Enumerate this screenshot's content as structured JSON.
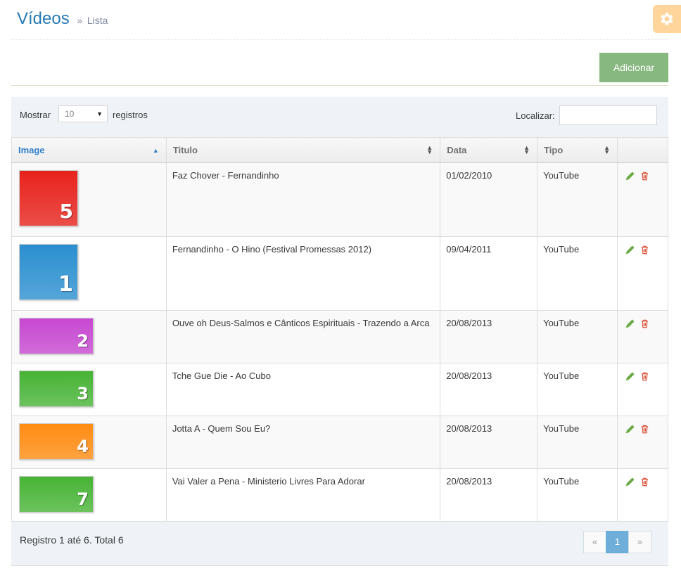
{
  "header": {
    "title": "Vídeos",
    "separator": "»",
    "subtitle": "Lista"
  },
  "toolbar": {
    "add_label": "Adicionar"
  },
  "controls": {
    "show_label": "Mostrar",
    "page_size": "10",
    "records_label": "registros",
    "search_label": "Localizar:",
    "search_value": ""
  },
  "columns": [
    "Image",
    "Titulo",
    "Data",
    "Tipo"
  ],
  "rows": [
    {
      "thumb_label": "5",
      "thumb_color": "#e8221c",
      "title": "Faz Chover - Fernandinho",
      "date": "01/02/2010",
      "type": "YouTube"
    },
    {
      "thumb_label": "1",
      "thumb_color": "#2b8fd0",
      "title": "Fernandinho - O Hino (Festival Promessas 2012)",
      "date": "09/04/2011",
      "type": "YouTube"
    },
    {
      "thumb_label": "2",
      "thumb_color": "#c748d1",
      "title": "Ouve oh Deus-Salmos e Cânticos Espirituais - Trazendo a Arca",
      "date": "20/08/2013",
      "type": "YouTube"
    },
    {
      "thumb_label": "3",
      "thumb_color": "#47b335",
      "title": "Tche Gue Die - Ao Cubo",
      "date": "20/08/2013",
      "type": "YouTube"
    },
    {
      "thumb_label": "4",
      "thumb_color": "#ff8c12",
      "title": "Jotta A - Quem Sou Eu?",
      "date": "20/08/2013",
      "type": "YouTube"
    },
    {
      "thumb_label": "7",
      "thumb_color": "#47b335",
      "title": "Vai Valer a Pena - Ministerio Livres Para Adorar",
      "date": "20/08/2013",
      "type": "YouTube"
    }
  ],
  "footer": {
    "info": "Registro 1 até 6. Total 6"
  },
  "pagination": {
    "prev": "«",
    "current": "1",
    "next": "»"
  },
  "colors": {
    "title": "#2679b5",
    "add_button": "#87b87f",
    "settings": "#ffb44b",
    "edit_icon": "#69aa46",
    "delete_icon": "#dd5a43",
    "active_page": "#6faed9"
  },
  "icons": {
    "settings": "gear-icon",
    "edit": "pencil-icon",
    "delete": "trash-icon",
    "sort": "sort-icon"
  }
}
